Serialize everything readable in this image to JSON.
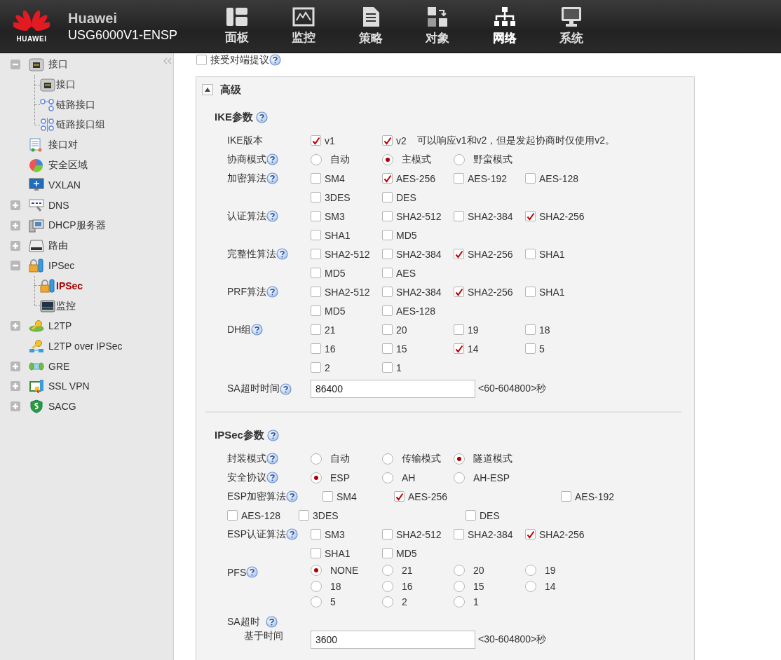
{
  "header": {
    "logo_text": "HUAWEI",
    "title": "Huawei",
    "model": "USG6000V1-ENSP",
    "nav": [
      {
        "label": "面板",
        "selected": false
      },
      {
        "label": "监控",
        "selected": false
      },
      {
        "label": "策略",
        "selected": false
      },
      {
        "label": "对象",
        "selected": false
      },
      {
        "label": "网络",
        "selected": true
      },
      {
        "label": "系统",
        "selected": false
      }
    ]
  },
  "sidebar": {
    "items": [
      {
        "label": "接口",
        "kind": "group",
        "expanded": true,
        "children": [
          {
            "label": "接口",
            "selected": false
          },
          {
            "label": "链路接口",
            "selected": false
          },
          {
            "label": "链路接口组",
            "selected": false
          }
        ]
      },
      {
        "label": "接口对",
        "kind": "leaf"
      },
      {
        "label": "安全区域",
        "kind": "leaf"
      },
      {
        "label": "VXLAN",
        "kind": "leaf"
      },
      {
        "label": "DNS",
        "kind": "group",
        "expanded": false
      },
      {
        "label": "DHCP服务器",
        "kind": "group",
        "expanded": false
      },
      {
        "label": "路由",
        "kind": "group",
        "expanded": false
      },
      {
        "label": "IPSec",
        "kind": "group",
        "expanded": true,
        "children": [
          {
            "label": "IPSec",
            "selected": true
          },
          {
            "label": "监控",
            "selected": false
          }
        ]
      },
      {
        "label": "L2TP",
        "kind": "group",
        "expanded": false
      },
      {
        "label": "L2TP over IPSec",
        "kind": "leaf"
      },
      {
        "label": "GRE",
        "kind": "group",
        "expanded": false
      },
      {
        "label": "SSL VPN",
        "kind": "group",
        "expanded": false
      },
      {
        "label": "SACG",
        "kind": "group",
        "expanded": false
      }
    ]
  },
  "accept_peer_proposal": {
    "label": "接受对端提议",
    "checked": false,
    "help": true
  },
  "advanced": {
    "title": "高级",
    "expanded": true,
    "sections": [
      {
        "title": "IKE参数",
        "help": true,
        "rows": [
          {
            "label": "IKE版本",
            "help": false,
            "kind": "check",
            "options": [
              {
                "label": "v1",
                "checked": true
              },
              {
                "label": "v2",
                "checked": true
              }
            ],
            "note": "可以响应v1和v2，但是发起协商时仅使用v2。"
          },
          {
            "label": "协商模式",
            "help": true,
            "kind": "radio",
            "options": [
              {
                "label": "自动",
                "selected": false
              },
              {
                "label": "主模式",
                "selected": true
              },
              {
                "label": "野蛮模式",
                "selected": false
              }
            ]
          },
          {
            "label": "加密算法",
            "help": true,
            "kind": "check",
            "options": [
              {
                "label": "SM4",
                "checked": false
              },
              {
                "label": "AES-256",
                "checked": true
              },
              {
                "label": "AES-192",
                "checked": false
              },
              {
                "label": "AES-128",
                "checked": false
              },
              {
                "label": "3DES",
                "checked": false
              },
              {
                "label": "DES",
                "checked": false
              }
            ]
          },
          {
            "label": "认证算法",
            "help": true,
            "kind": "check",
            "options": [
              {
                "label": "SM3",
                "checked": false
              },
              {
                "label": "SHA2-512",
                "checked": false
              },
              {
                "label": "SHA2-384",
                "checked": false
              },
              {
                "label": "SHA2-256",
                "checked": true
              },
              {
                "label": "SHA1",
                "checked": false
              },
              {
                "label": "MD5",
                "checked": false
              }
            ]
          },
          {
            "label": "完整性算法",
            "help": true,
            "kind": "check",
            "options": [
              {
                "label": "SHA2-512",
                "checked": false
              },
              {
                "label": "SHA2-384",
                "checked": false
              },
              {
                "label": "SHA2-256",
                "checked": true
              },
              {
                "label": "SHA1",
                "checked": false
              },
              {
                "label": "MD5",
                "checked": false
              },
              {
                "label": "AES",
                "checked": false
              }
            ]
          },
          {
            "label": "PRF算法",
            "help": true,
            "kind": "check",
            "options": [
              {
                "label": "SHA2-512",
                "checked": false
              },
              {
                "label": "SHA2-384",
                "checked": false
              },
              {
                "label": "SHA2-256",
                "checked": true
              },
              {
                "label": "SHA1",
                "checked": false
              },
              {
                "label": "MD5",
                "checked": false
              },
              {
                "label": "AES-128",
                "checked": false
              }
            ]
          },
          {
            "label": "DH组",
            "help": true,
            "kind": "check",
            "options": [
              {
                "label": "21",
                "checked": false
              },
              {
                "label": "20",
                "checked": false
              },
              {
                "label": "19",
                "checked": false
              },
              {
                "label": "18",
                "checked": false
              },
              {
                "label": "16",
                "checked": false
              },
              {
                "label": "15",
                "checked": false
              },
              {
                "label": "14",
                "checked": true
              },
              {
                "label": "5",
                "checked": false
              },
              {
                "label": "2",
                "checked": false
              },
              {
                "label": "1",
                "checked": false
              }
            ]
          },
          {
            "label": "SA超时时间",
            "help": true,
            "kind": "input",
            "value": "86400",
            "hint": "<60-604800>秒"
          }
        ]
      },
      {
        "title": "IPSec参数",
        "help": true,
        "rows": [
          {
            "label": "封装模式",
            "help": true,
            "kind": "radio",
            "options": [
              {
                "label": "自动",
                "selected": false
              },
              {
                "label": "传输模式",
                "selected": false
              },
              {
                "label": "隧道模式",
                "selected": true
              }
            ]
          },
          {
            "label": "安全协议",
            "help": true,
            "kind": "radio",
            "options": [
              {
                "label": "ESP",
                "selected": true
              },
              {
                "label": "AH",
                "selected": false
              },
              {
                "label": "AH-ESP",
                "selected": false
              }
            ]
          },
          {
            "label": "ESP加密算法",
            "help": true,
            "kind": "check_wrapped",
            "options": [
              {
                "label": "SM4",
                "checked": false
              },
              {
                "label": "AES-256",
                "checked": true
              },
              {
                "label": "AES-192",
                "checked": false
              },
              {
                "label": "AES-128",
                "checked": false
              },
              {
                "label": "3DES",
                "checked": false
              },
              {
                "label": "DES",
                "checked": false
              }
            ]
          },
          {
            "label": "ESP认证算法",
            "help": true,
            "kind": "check",
            "options": [
              {
                "label": "SM3",
                "checked": false
              },
              {
                "label": "SHA2-512",
                "checked": false
              },
              {
                "label": "SHA2-384",
                "checked": false
              },
              {
                "label": "SHA2-256",
                "checked": true
              },
              {
                "label": "SHA1",
                "checked": false
              },
              {
                "label": "MD5",
                "checked": false
              }
            ]
          },
          {
            "label": "PFS",
            "help": true,
            "kind": "radio_compact",
            "options": [
              {
                "label": "NONE",
                "selected": true
              },
              {
                "label": "21",
                "selected": false
              },
              {
                "label": "20",
                "selected": false
              },
              {
                "label": "19",
                "selected": false
              },
              {
                "label": "18",
                "selected": false
              },
              {
                "label": "16",
                "selected": false
              },
              {
                "label": "15",
                "selected": false
              },
              {
                "label": "14",
                "selected": false
              },
              {
                "label": "5",
                "selected": false
              },
              {
                "label": "2",
                "selected": false
              },
              {
                "label": "1",
                "selected": false
              }
            ]
          },
          {
            "label": "SA超时",
            "help": true,
            "kind": "input_sub",
            "sublabel": "基于时间",
            "value": "3600",
            "hint": "<30-604800>秒"
          }
        ]
      }
    ]
  }
}
